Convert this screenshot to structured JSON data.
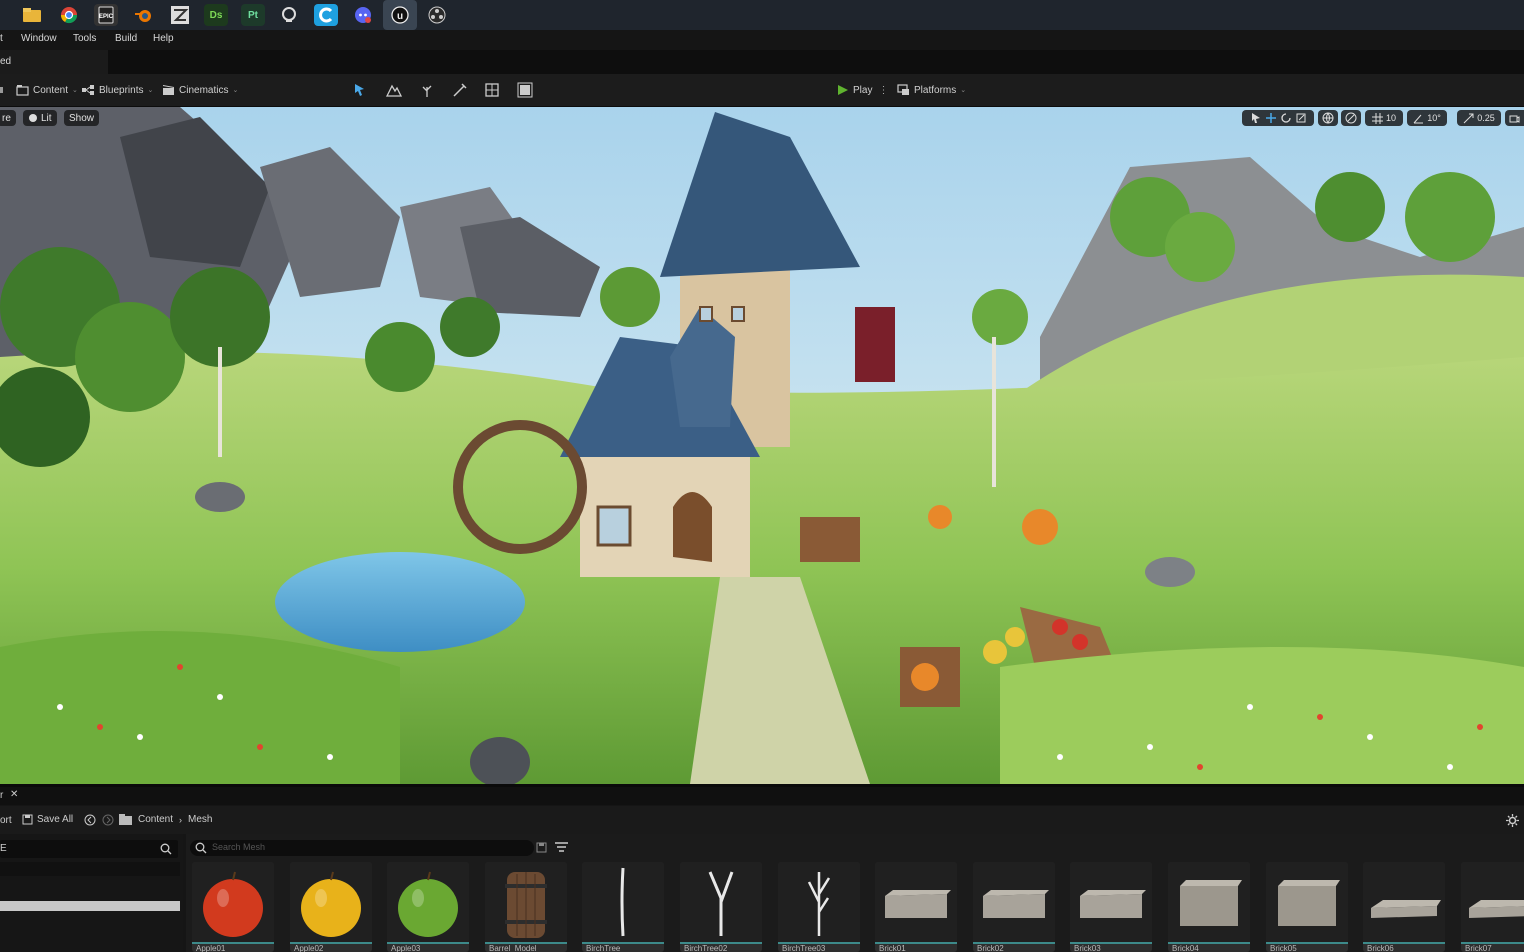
{
  "menubar": {
    "items": [
      "t",
      "Window",
      "Tools",
      "Build",
      "Help"
    ]
  },
  "tabstrip": {
    "tab_label": "ed"
  },
  "toolbar": {
    "content_label": "Content",
    "blueprints_label": "Blueprints",
    "cinematics_label": "Cinematics",
    "play_label": "Play",
    "platforms_label": "Platforms"
  },
  "viewport": {
    "perspective_label": "re",
    "lit_label": "Lit",
    "show_label": "Show",
    "grid_snap_value": "10",
    "rotation_snap_value": "10°",
    "scale_snap_value": "0.25"
  },
  "content_browser": {
    "tab_label": "r",
    "import_label": "ort",
    "save_all_label": "Save All",
    "breadcrumb": [
      "Content",
      "Mesh"
    ],
    "left_search_text": "E",
    "search_placeholder": "Search Mesh",
    "assets": [
      {
        "name": "Apple01",
        "type": "apple",
        "color": "#d23a1e"
      },
      {
        "name": "Apple02",
        "type": "apple",
        "color": "#e8b21a"
      },
      {
        "name": "Apple03",
        "type": "apple",
        "color": "#6aa832"
      },
      {
        "name": "Barrel_Model",
        "type": "barrel",
        "color": "#6b4a32"
      },
      {
        "name": "BirchTree",
        "type": "branch",
        "color": "#e8e8e8"
      },
      {
        "name": "BirchTree02",
        "type": "branch",
        "color": "#e8e8e8"
      },
      {
        "name": "BirchTree03",
        "type": "branch",
        "color": "#e8e8e8"
      },
      {
        "name": "Brick01",
        "type": "brick",
        "color": "#a8a39a"
      },
      {
        "name": "Brick02",
        "type": "brick",
        "color": "#a8a39a"
      },
      {
        "name": "Brick03",
        "type": "brick",
        "color": "#a8a39a"
      },
      {
        "name": "Brick04",
        "type": "brick",
        "color": "#9c978d"
      },
      {
        "name": "Brick05",
        "type": "brick",
        "color": "#9c978d"
      },
      {
        "name": "Brick06",
        "type": "slab",
        "color": "#a8a39a"
      },
      {
        "name": "Brick07",
        "type": "slab",
        "color": "#a8a39a"
      }
    ]
  },
  "colors": {
    "taskbar": "#1f252d",
    "editor_bg": "#151515",
    "play_green": "#5fb32f",
    "asset_underline": "#3d8a8a"
  }
}
